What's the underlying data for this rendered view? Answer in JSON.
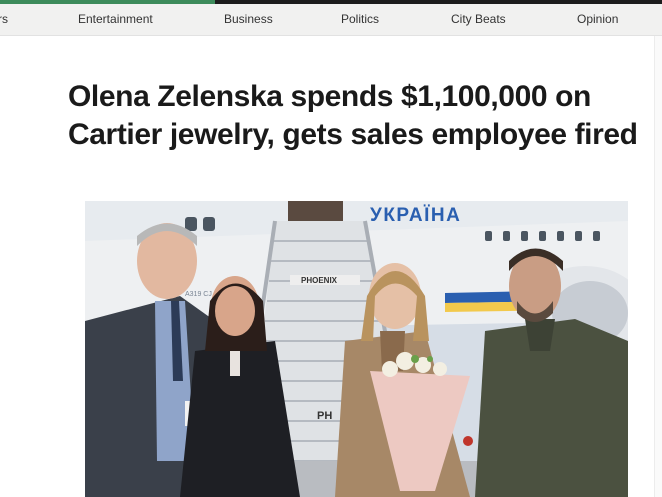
{
  "nav": {
    "items": [
      {
        "label": "rs"
      },
      {
        "label": "Entertainment"
      },
      {
        "label": "Business"
      },
      {
        "label": "Politics"
      },
      {
        "label": "City Beats"
      },
      {
        "label": "Opinion"
      }
    ]
  },
  "article": {
    "headline_line1": "Olena Zelenska spends $1,100,000 on",
    "headline_line2": "Cartier jewelry, gets sales employee fired"
  },
  "photo": {
    "plane_text": "УКРАЇНА",
    "stairs_text_top": "PHOENIX",
    "stairs_text_bottom": "PH",
    "plane_code": "A319 CJ"
  },
  "colors": {
    "nav_bg": "#f1f1f0",
    "accent": "#3d8b5b",
    "plane_blue": "#2a5fb0",
    "plane_yellow": "#f2c94c"
  }
}
